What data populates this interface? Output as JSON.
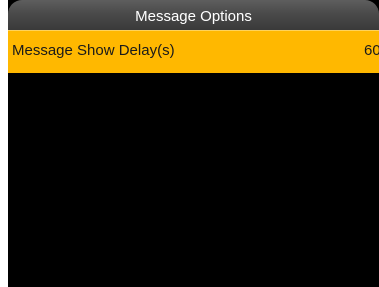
{
  "title_bar": {
    "title": "Message Options"
  },
  "menu": {
    "items": [
      {
        "label": "Message Show Delay(s)",
        "value": "60",
        "selected": true
      }
    ]
  },
  "colors": {
    "screen_background": "#000000",
    "title_bar": "#4a4a4a",
    "title_text": "#ffffff",
    "selected_row": "#ffb800",
    "row_text": "#1a1a1a"
  }
}
